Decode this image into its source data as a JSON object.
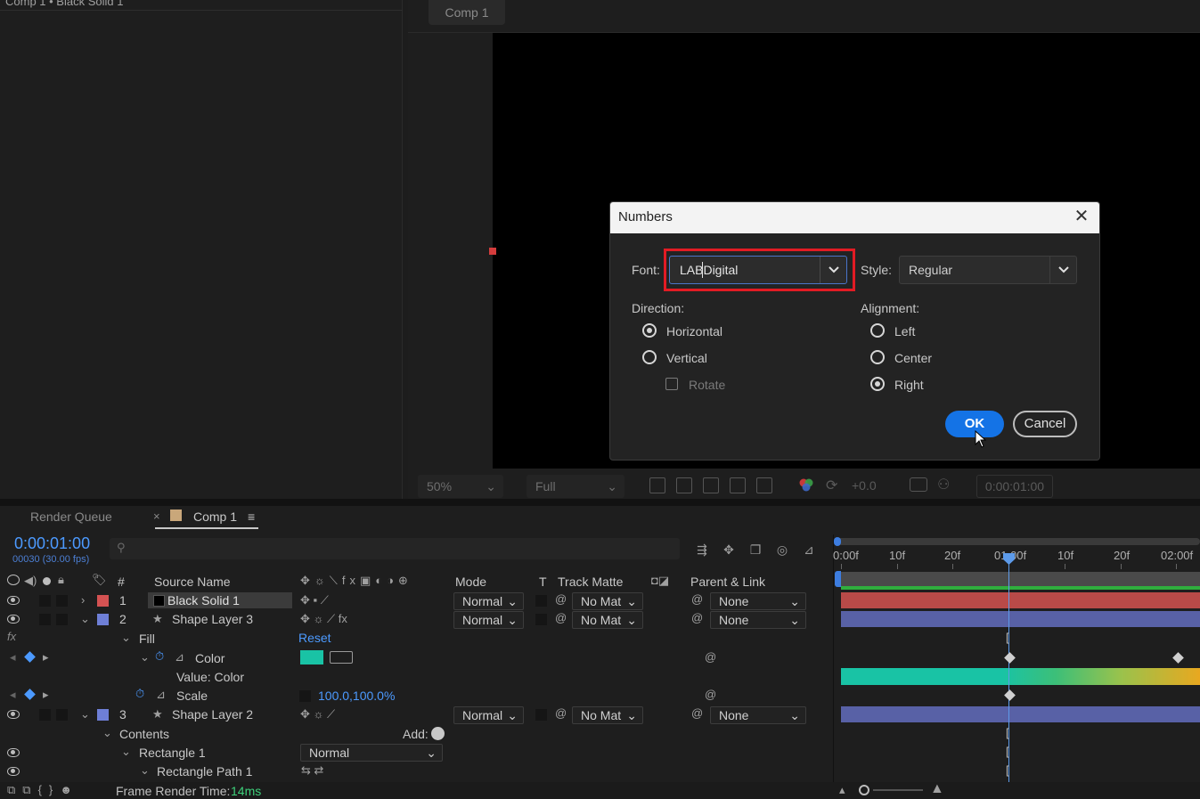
{
  "effect_panel": {
    "title": "Comp 1 • Black Solid 1"
  },
  "viewer": {
    "tab_label": "Comp 1",
    "zoom": "50%",
    "resolution": "Full",
    "exposure": "+0.0",
    "current_time": "0:00:01:00"
  },
  "dialog": {
    "title": "Numbers",
    "close_glyph": "✕",
    "font_label": "Font:",
    "font_value": "LABDigital",
    "style_label": "Style:",
    "style_value": "Regular",
    "direction_label": "Direction:",
    "direction_options": [
      "Horizontal",
      "Vertical"
    ],
    "direction_selected": "Horizontal",
    "rotate_label": "Rotate",
    "rotate_checked": false,
    "alignment_label": "Alignment:",
    "alignment_options": [
      "Left",
      "Center",
      "Right"
    ],
    "alignment_selected": "Right",
    "ok_label": "OK",
    "cancel_label": "Cancel",
    "highlight_color": "#e21b24",
    "accent_color": "#1473e6"
  },
  "timeline": {
    "tabs": [
      {
        "label": "Render Queue",
        "close": "×"
      },
      {
        "label": "Comp 1",
        "menu": "≡"
      }
    ],
    "current_time": "0:00:01:00",
    "frame_info": "00030 (30.00 fps)",
    "search_icon": "⚲",
    "columns": {
      "hash": "#",
      "source_name": "Source Name",
      "mode": "Mode",
      "t": "T",
      "track_matte": "Track Matte",
      "parent": "Parent & Link"
    },
    "ruler_labels": [
      "0:00f",
      "10f",
      "20f",
      "01:00f",
      "10f",
      "20f",
      "02:00f"
    ],
    "layers": [
      {
        "index": "1",
        "name": "Black Solid 1",
        "label_color": "#d45252",
        "mode": "Normal",
        "matte": "No Mat",
        "parent": "None",
        "bar_color": "#b94a48"
      },
      {
        "index": "2",
        "name": "Shape Layer 3",
        "label_color": "#6e7fd6",
        "mode": "Normal",
        "matte": "No Mat",
        "parent": "None",
        "bar_color": "#5861a6"
      },
      {
        "index": "3",
        "name": "Shape Layer 2",
        "label_color": "#6e7fd6",
        "mode": "Normal",
        "matte": "No Mat",
        "parent": "None",
        "bar_color": "#5861a6"
      }
    ],
    "properties": {
      "fx_glyph": "fx",
      "fill": "Fill",
      "reset": "Reset",
      "color": "Color",
      "color_swatch": "#19c3a5",
      "value_color": "Value: Color",
      "scale": "Scale",
      "scale_value": "100.0,100.0%",
      "contents": "Contents",
      "add": "Add:",
      "rectangle": "Rectangle 1",
      "rectangle_mode": "Normal",
      "rectangle_path": "Rectangle Path 1"
    }
  },
  "footer": {
    "render_time_label": "Frame Render Time:",
    "render_time_value": "14ms"
  }
}
